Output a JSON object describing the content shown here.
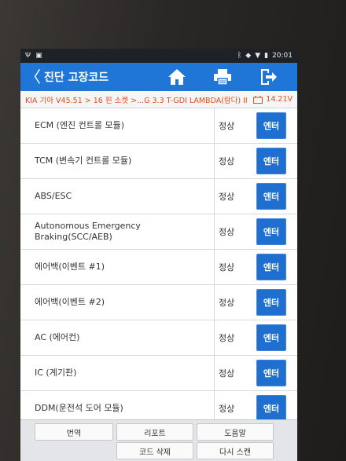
{
  "status_bar": {
    "time": "20:01"
  },
  "app_bar": {
    "back_glyph": "〈",
    "title": "진단 고장코드",
    "icons": [
      "home-icon",
      "printer-icon",
      "exit-icon"
    ]
  },
  "breadcrumb": {
    "path": "KIA 기아 V45.51 > 16 핀 소켓 >...G 3.3 T-GDI LAMBDA(람다) II",
    "voltage": "14.21V"
  },
  "modules": [
    {
      "name": "ECM (엔진 컨트롤 모듈)",
      "status": "정상",
      "action": "엔터"
    },
    {
      "name": "TCM (변속기 컨트롤 모듈)",
      "status": "정상",
      "action": "엔터"
    },
    {
      "name": "ABS/ESC",
      "status": "정상",
      "action": "엔터"
    },
    {
      "name": "Autonomous Emergency Braking(SCC/AEB)",
      "status": "정상",
      "action": "엔터"
    },
    {
      "name": "에어백(이벤트 #1)",
      "status": "정상",
      "action": "엔터"
    },
    {
      "name": "에어백(이벤트 #2)",
      "status": "정상",
      "action": "엔터"
    },
    {
      "name": "AC (에어컨)",
      "status": "정상",
      "action": "엔터"
    },
    {
      "name": "IC (계기판)",
      "status": "정상",
      "action": "엔터"
    },
    {
      "name": "DDM(운전석 도어 모듈)",
      "status": "정상",
      "action": "엔터"
    }
  ],
  "bottom_buttons": {
    "translate": "번역",
    "report": "리포트",
    "help": "도움말",
    "clear_codes": "코드 삭제",
    "rescan": "다시 스캔"
  },
  "colors": {
    "accent": "#1f76d6",
    "button": "#1f6fd0",
    "breadcrumb_text": "#e34b1a"
  }
}
